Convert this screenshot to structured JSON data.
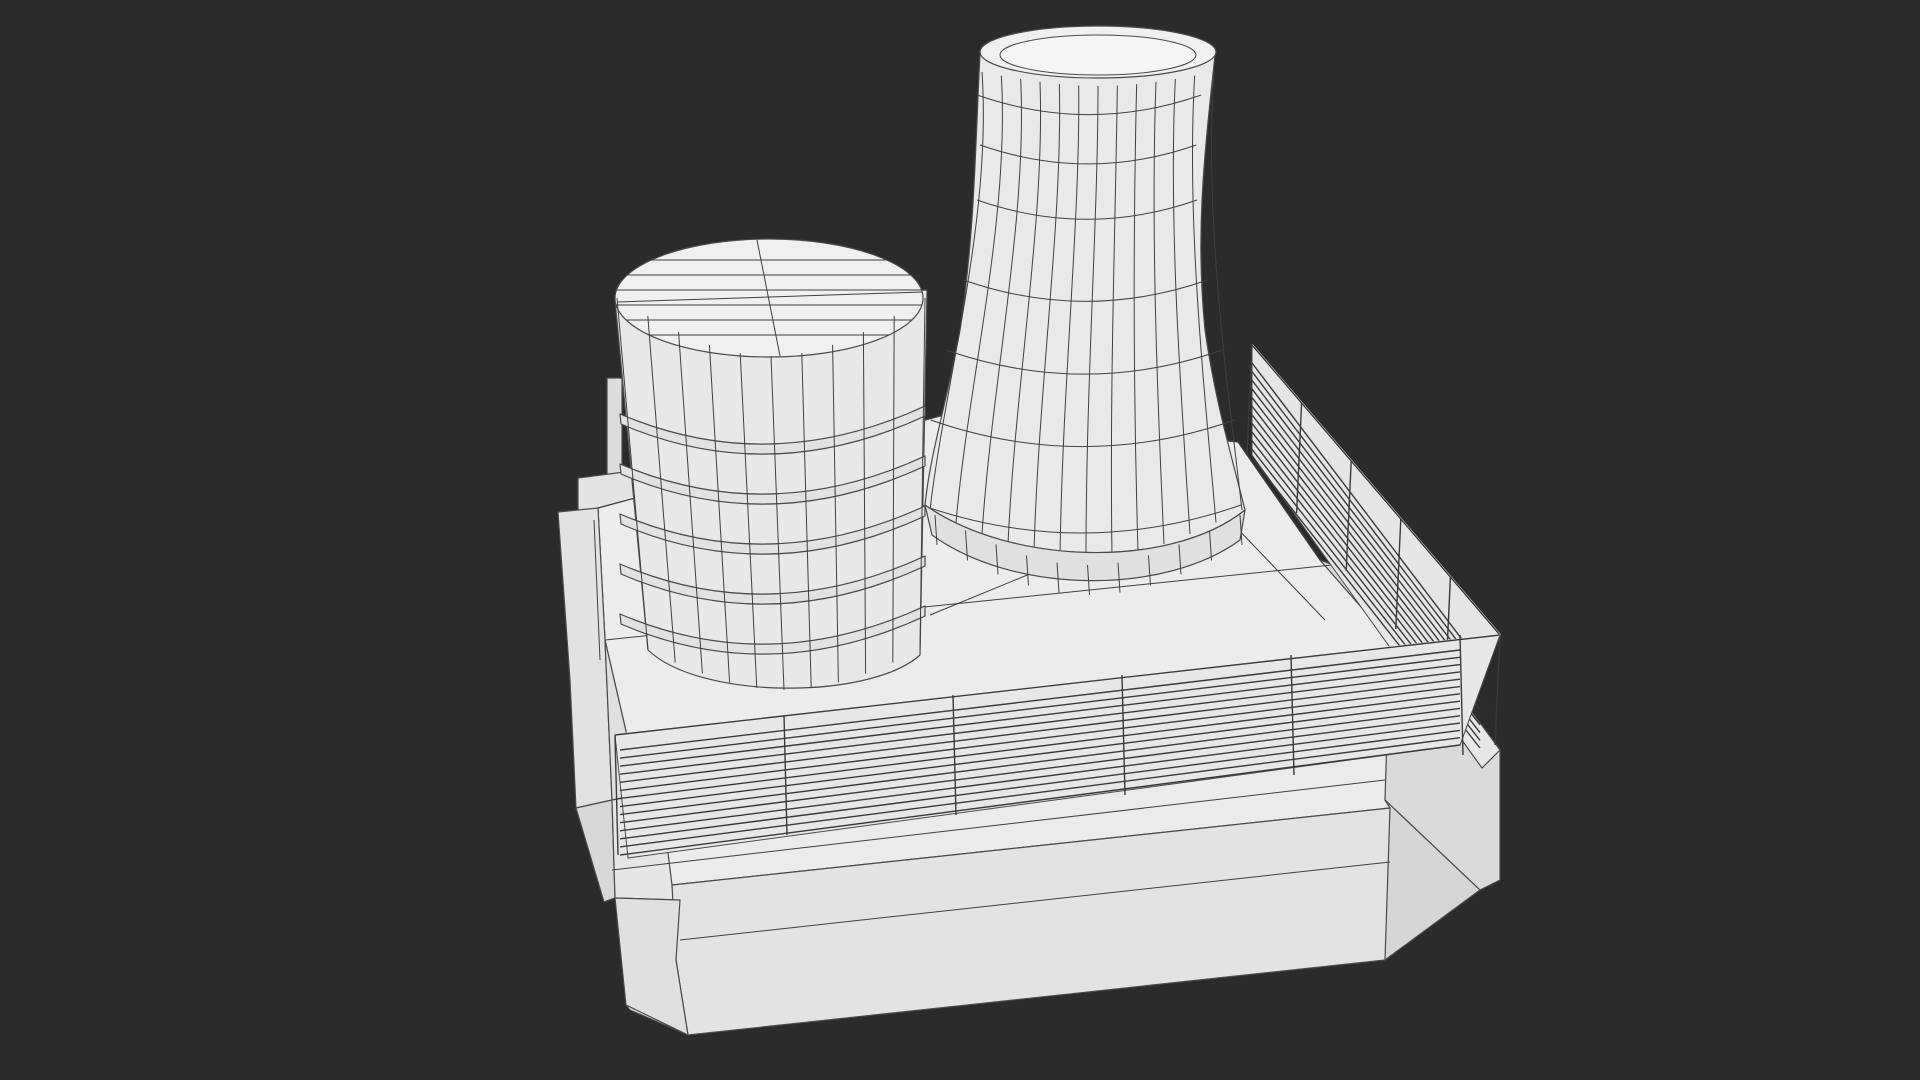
{
  "scene": {
    "background_color": "#2b2b2b",
    "surface_color_top": "#ececec",
    "surface_color_side": "#dedede",
    "surface_color_shadow": "#d2d2d2",
    "wireframe_color": "#3f3f3f",
    "objects": [
      "stepped-base-platform",
      "cylindrical-storage-tank",
      "hyperboloid-cooling-tower",
      "front-railing",
      "side-railing"
    ]
  }
}
